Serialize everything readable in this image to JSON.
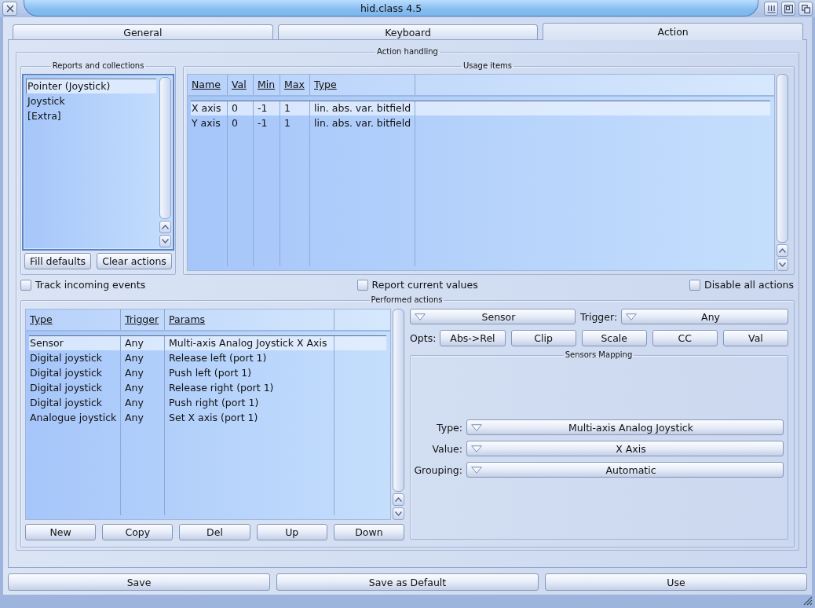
{
  "window": {
    "title": "hid.class 4.5"
  },
  "tabs": [
    {
      "label": "General",
      "selected": false
    },
    {
      "label": "Keyboard",
      "selected": false
    },
    {
      "label": "Action",
      "selected": true
    }
  ],
  "action_handling": {
    "title": "Action handling",
    "reports": {
      "title": "Reports and collections",
      "items": [
        {
          "label": "Pointer (Joystick)",
          "selected": true
        },
        {
          "label": "Joystick",
          "selected": false
        },
        {
          "label": "[Extra]",
          "selected": false
        }
      ],
      "buttons": [
        "Fill defaults",
        "Clear actions"
      ]
    },
    "usage_items": {
      "title": "Usage items",
      "columns": [
        "Name",
        "Val",
        "Min",
        "Max",
        "Type"
      ],
      "rows": [
        {
          "cells": [
            "X axis",
            "0",
            "-1",
            "1",
            "lin. abs. var. bitfield"
          ],
          "selected": true
        },
        {
          "cells": [
            "Y axis",
            "0",
            "-1",
            "1",
            "lin. abs. var. bitfield"
          ],
          "selected": false
        }
      ]
    },
    "options": [
      {
        "label": "Track incoming events",
        "checked": false
      },
      {
        "label": "Report current values",
        "checked": false
      },
      {
        "label": "Disable all actions",
        "checked": false
      }
    ],
    "performed_actions": {
      "title": "Performed actions",
      "columns": [
        "Type",
        "Trigger",
        "Params"
      ],
      "rows": [
        {
          "cells": [
            "Sensor",
            "Any",
            "Multi-axis Analog Joystick X Axis"
          ],
          "selected": true
        },
        {
          "cells": [
            "Digital joystick",
            "Any",
            "Release left (port 1)"
          ],
          "selected": false
        },
        {
          "cells": [
            "Digital joystick",
            "Any",
            "Push left (port 1)"
          ],
          "selected": false
        },
        {
          "cells": [
            "Digital joystick",
            "Any",
            "Release right (port 1)"
          ],
          "selected": false
        },
        {
          "cells": [
            "Digital joystick",
            "Any",
            "Push right (port 1)"
          ],
          "selected": false
        },
        {
          "cells": [
            "Analogue joystick",
            "Any",
            "Set X axis (port 1)"
          ],
          "selected": false
        }
      ],
      "buttons": [
        "New",
        "Copy",
        "Del",
        "Up",
        "Down"
      ],
      "action_type": "Sensor",
      "trigger_label": "Trigger:",
      "trigger": "Any",
      "opts_label": "Opts:",
      "opts": [
        "Abs->Rel",
        "Clip",
        "Scale",
        "CC",
        "Val"
      ],
      "sensors_mapping": {
        "title": "Sensors Mapping",
        "fields": [
          {
            "label": "Type:",
            "value": "Multi-axis Analog Joystick"
          },
          {
            "label": "Value:",
            "value": "X Axis"
          },
          {
            "label": "Grouping:",
            "value": "Automatic"
          }
        ]
      }
    }
  },
  "buttons": [
    "Save",
    "Save as Default",
    "Use"
  ]
}
